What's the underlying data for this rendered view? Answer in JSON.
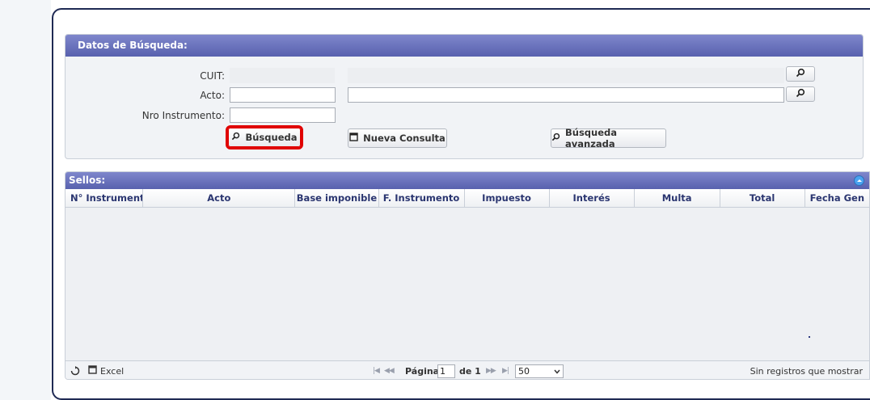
{
  "search": {
    "title": "Datos de Búsqueda:",
    "cuit_label": "CUIT:",
    "acto_label": "Acto:",
    "nro_label": "Nro Instrumento:",
    "busqueda_label": "Búsqueda",
    "nueva_consulta_label": "Nueva Consulta",
    "busqueda_avanzada_label": "Búsqueda avanzada"
  },
  "grid": {
    "title": "Sellos:",
    "columns": [
      "N° Instrumento",
      "Acto",
      "Base imponible",
      "F. Instrumento",
      "Impuesto",
      "Interés",
      "Multa",
      "Total",
      "Fecha Gen"
    ]
  },
  "pager": {
    "excel_label": "Excel",
    "pagina_label": "Página",
    "page_value": "1",
    "of_label": "de 1",
    "rows_per_page": "50",
    "status_text": "Sin registros que mostrar"
  },
  "icons": {
    "search": "magnifier-icon",
    "new": "document-icon",
    "refresh": "refresh-icon"
  },
  "colors": {
    "header_start": "#7f87cc",
    "header_end": "#5861ae",
    "highlight": "#e00000",
    "frame": "#1f2a54"
  }
}
